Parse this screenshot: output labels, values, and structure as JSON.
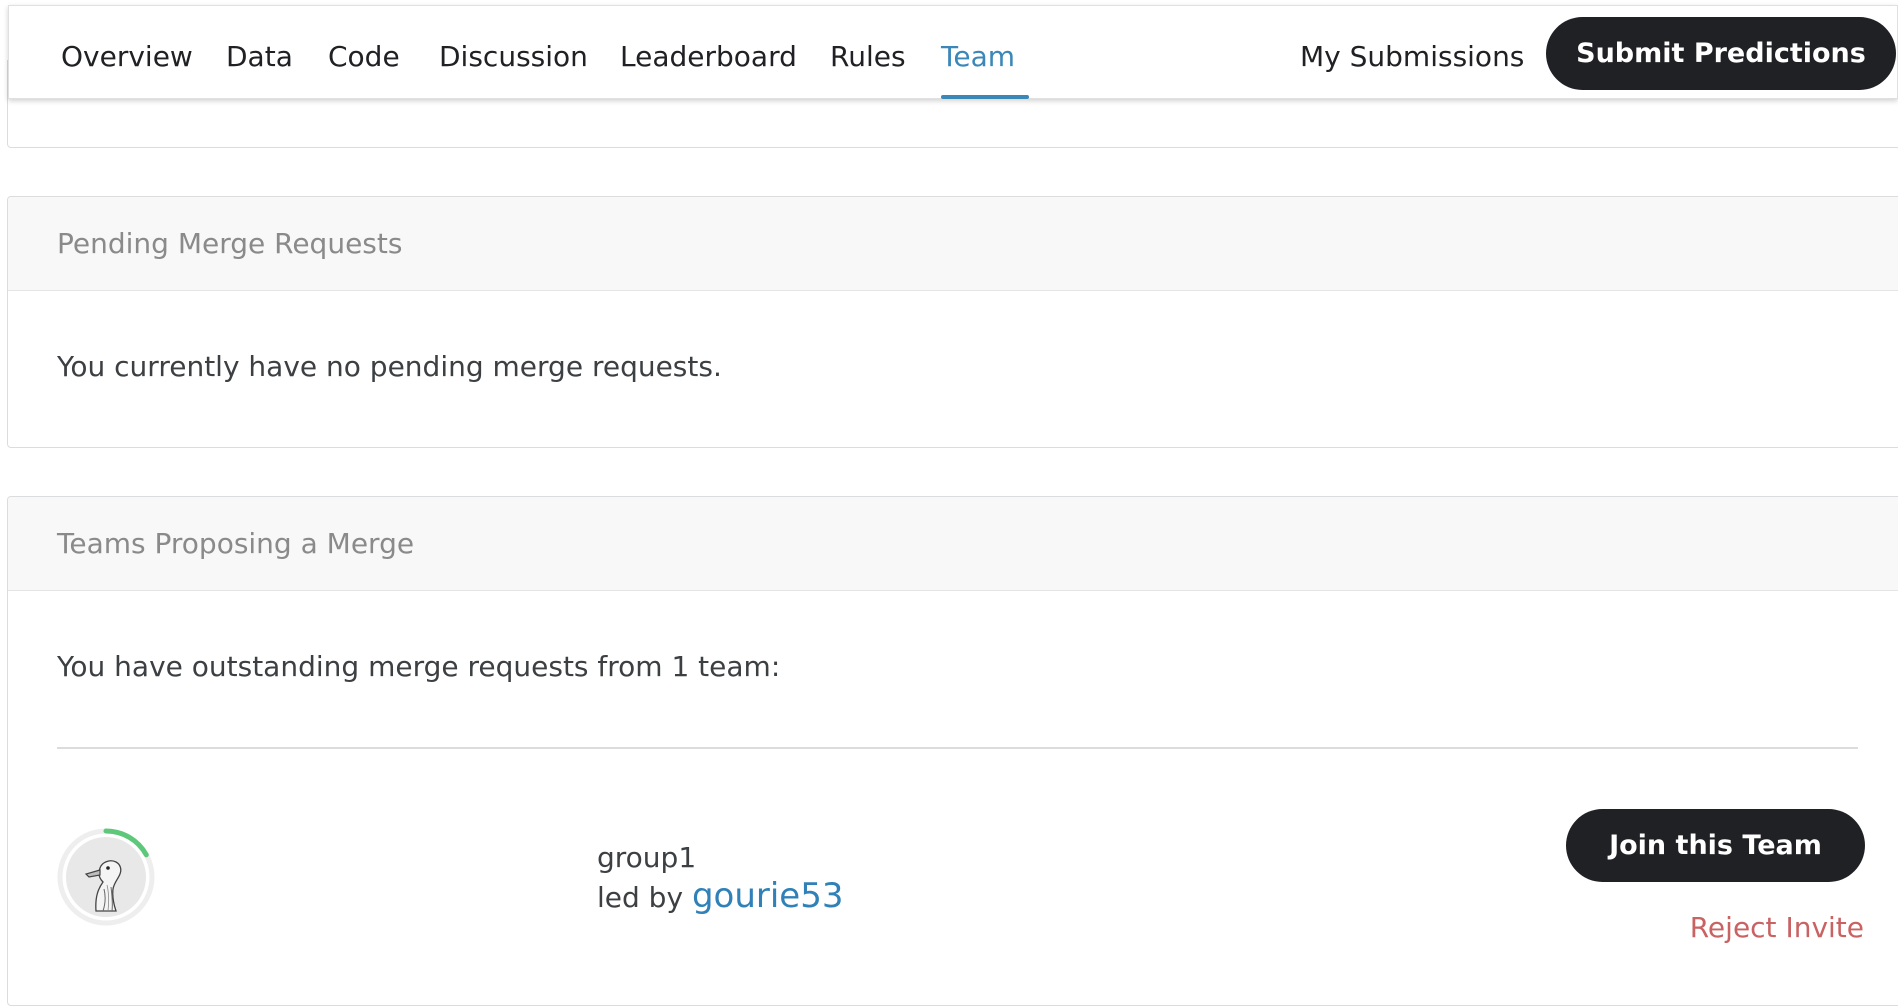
{
  "nav": {
    "tabs": [
      {
        "label": "Overview"
      },
      {
        "label": "Data"
      },
      {
        "label": "Code"
      },
      {
        "label": "Discussion"
      },
      {
        "label": "Leaderboard"
      },
      {
        "label": "Rules"
      },
      {
        "label": "Team",
        "active": true
      }
    ],
    "my_submissions_label": "My Submissions",
    "submit_label": "Submit Predictions"
  },
  "pending": {
    "title": "Pending Merge Requests",
    "message": "You currently have no pending merge requests."
  },
  "proposing": {
    "title": "Teams Proposing a Merge",
    "message": "You have outstanding merge requests from 1 team:",
    "teams": [
      {
        "name": "group1",
        "led_by_prefix": "led by ",
        "leader": "gourie53",
        "join_label": "Join this Team",
        "reject_label": "Reject Invite",
        "avatar_icon": "goose-avatar-icon",
        "progress_fraction": 0.17
      }
    ]
  },
  "colors": {
    "accent": "#3a87b8",
    "button_dark": "#202124",
    "reject": "#c96363",
    "progress_ring": "#5ec87a"
  }
}
